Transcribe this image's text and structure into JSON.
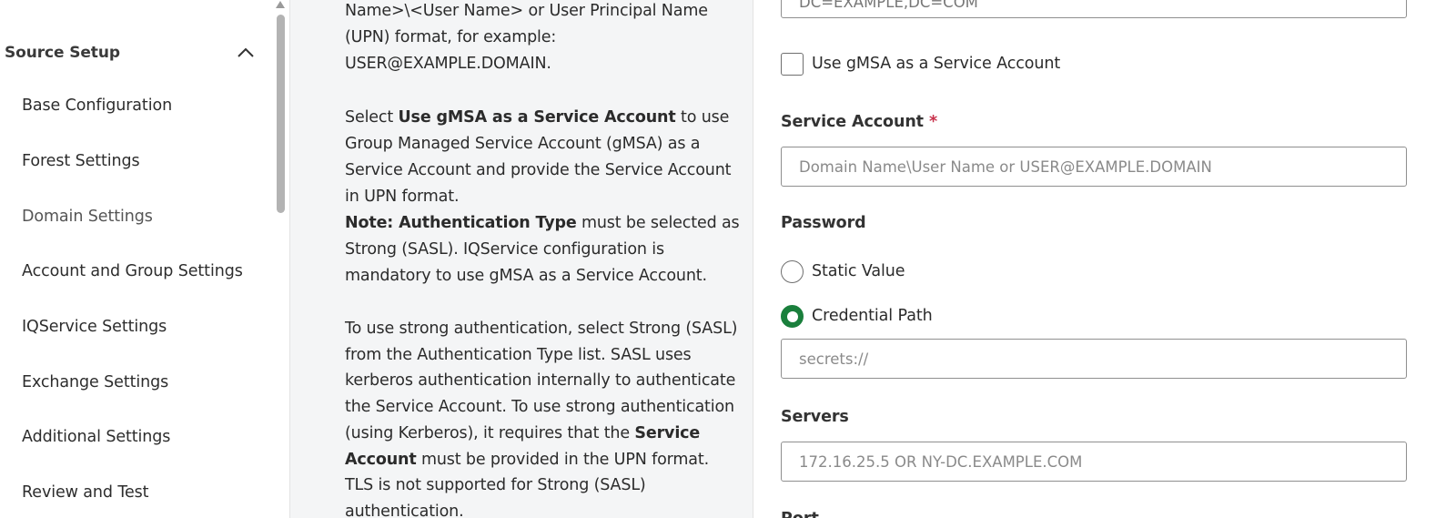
{
  "sidebar": {
    "section_title": "Source Setup",
    "items": [
      {
        "label": "Base Configuration"
      },
      {
        "label": "Forest Settings"
      },
      {
        "label": "Domain Settings"
      },
      {
        "label": "Account and Group Settings"
      },
      {
        "label": "IQService Settings"
      },
      {
        "label": "Exchange Settings"
      },
      {
        "label": "Additional Settings"
      },
      {
        "label": "Review and Test"
      }
    ]
  },
  "help": {
    "l1": "Name>\\<User Name> or User Principal Name",
    "l2": "(UPN) format, for example:",
    "l3": "USER@EXAMPLE.DOMAIN.",
    "p2_pre": "Select ",
    "p2_bold": "Use gMSA as a Service Account",
    "p2_post": " to use",
    "l5": "Group Managed Service Account (gMSA) as a",
    "l6": "Service Account and provide the Service Account",
    "l7": "in UPN format.",
    "note_bold": "Note: Authentication Type",
    "note_post": " must be selected as",
    "l9": "Strong (SASL). IQService configuration is",
    "l10": "mandatory to use gMSA as a Service Account.",
    "l11": "To use strong authentication, select Strong (SASL)",
    "l12": "from the Authentication Type list. SASL uses",
    "l13": "kerberos authentication internally to authenticate",
    "l14": "the Service Account. To use strong authentication",
    "l15_pre": "(using Kerberos), it requires that the ",
    "l15_bold": "Service",
    "l16_bold": "Account",
    "l16_post": " must be provided in the UPN format.",
    "l17": "TLS is not supported for Strong (SASL)",
    "l18": "authentication."
  },
  "form": {
    "top_field_value": "DC=EXAMPLE,DC=COM",
    "gmsa_checkbox_label": "Use gMSA as a Service Account",
    "service_account_label": "Service Account",
    "required_mark": "*",
    "service_account_placeholder": "Domain Name\\User Name or USER@EXAMPLE.DOMAIN",
    "password_label": "Password",
    "static_value_label": "Static Value",
    "credential_path_label": "Credential Path",
    "credential_path_placeholder": "secrets://",
    "servers_label": "Servers",
    "servers_placeholder": "172.16.25.5 OR NY-DC.EXAMPLE.COM",
    "port_label": "Port"
  },
  "colors": {
    "accent_green": "#1a7f3c",
    "required_red": "#c8314b",
    "help_bg": "#f4f5f6"
  }
}
